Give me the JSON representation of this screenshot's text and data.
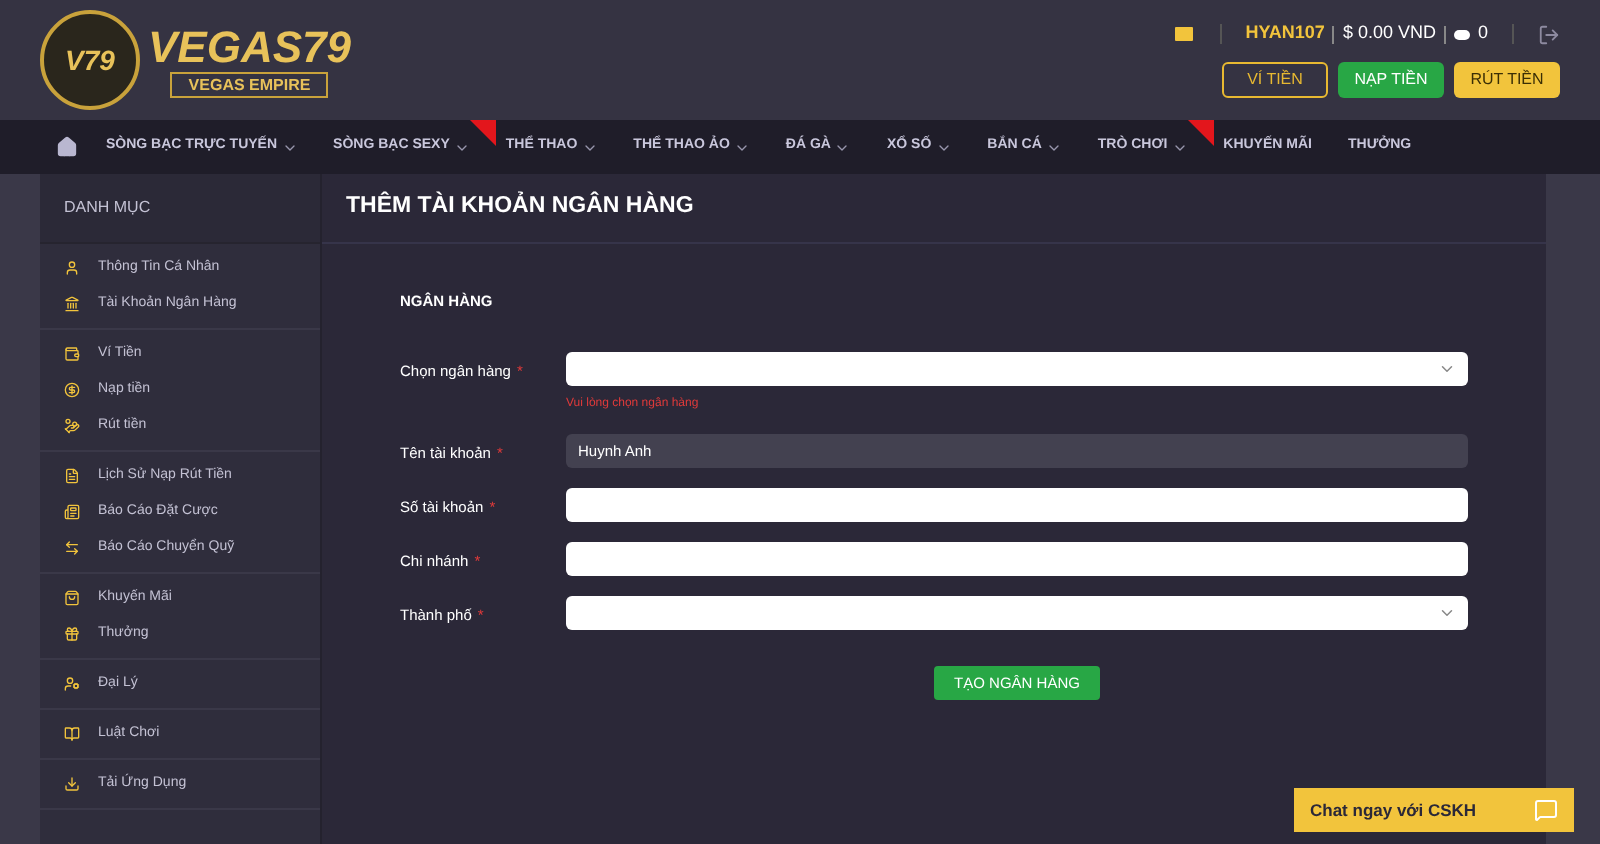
{
  "logo": {
    "emblem": "V79",
    "name": "VEGAS79",
    "tagline": "VEGAS EMPIRE"
  },
  "account": {
    "username": "HYAN107",
    "balance": "$ 0.00 VND",
    "points": "0"
  },
  "header_buttons": [
    {
      "label": "VÍ TIỀN",
      "kind": "outline"
    },
    {
      "label": "NẠP TIỀN",
      "kind": "green"
    },
    {
      "label": "RÚT TIỀN",
      "kind": "yellow"
    }
  ],
  "nav": [
    {
      "label": "SÒNG BẠC TRỰC TUYẾN",
      "dropdown": true,
      "hot": false
    },
    {
      "label": "SÒNG BẠC SEXY",
      "dropdown": true,
      "hot": true
    },
    {
      "label": "THỂ THAO",
      "dropdown": true,
      "hot": false
    },
    {
      "label": "THỂ THAO ẢO",
      "dropdown": true,
      "hot": false
    },
    {
      "label": "ĐÁ GÀ",
      "dropdown": true,
      "hot": false
    },
    {
      "label": "XỔ SỐ",
      "dropdown": true,
      "hot": false
    },
    {
      "label": "BẮN CÁ",
      "dropdown": true,
      "hot": false
    },
    {
      "label": "TRÒ CHƠI",
      "dropdown": true,
      "hot": true
    },
    {
      "label": "KHUYẾN MÃI",
      "dropdown": false,
      "hot": false
    },
    {
      "label": "THƯỞNG",
      "dropdown": false,
      "hot": false
    }
  ],
  "sidebar": {
    "title": "DANH MỤC",
    "groups": [
      [
        {
          "label": "Thông Tin Cá Nhân"
        },
        {
          "label": "Tài Khoản Ngân Hàng"
        }
      ],
      [
        {
          "label": "Ví Tiền"
        },
        {
          "label": "Nạp tiền"
        },
        {
          "label": "Rút tiền"
        }
      ],
      [
        {
          "label": "Lịch Sử Nạp Rút Tiền"
        },
        {
          "label": "Báo Cáo Đặt Cược"
        },
        {
          "label": "Báo Cáo Chuyển Quỹ"
        }
      ],
      [
        {
          "label": "Khuyến Mãi"
        },
        {
          "label": "Thưởng"
        }
      ],
      [
        {
          "label": "Đại Lý"
        }
      ],
      [
        {
          "label": "Luật Chơi"
        }
      ],
      [
        {
          "label": "Tải Ứng Dụng"
        }
      ]
    ]
  },
  "page_title": "THÊM TÀI KHOẢN NGÂN HÀNG",
  "section_title": "NGÂN HÀNG",
  "fields": [
    {
      "label": "Chọn ngân hàng",
      "required": true,
      "kind": "select",
      "error": "Vui lòng chọn ngân hàng"
    },
    {
      "label": "Tên tài khoản",
      "required": true,
      "kind": "readonly",
      "value": "Huynh Anh"
    },
    {
      "label": "Số tài khoản",
      "required": true,
      "kind": "text"
    },
    {
      "label": "Chi nhánh",
      "required": true,
      "kind": "text"
    },
    {
      "label": "Thành phố",
      "required": true,
      "kind": "select"
    }
  ],
  "required_mark": "*",
  "submit": "TẠO NGÂN HÀNG",
  "chat": "Chat ngay với CSKH"
}
